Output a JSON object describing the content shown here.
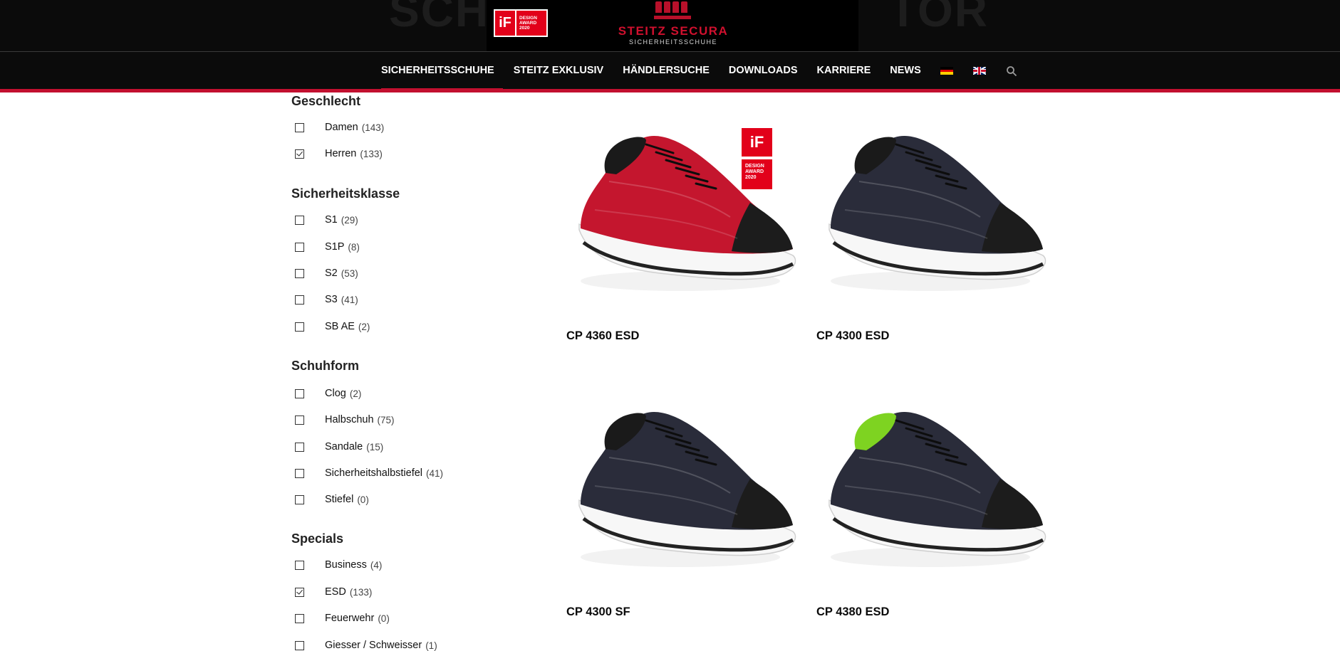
{
  "header": {
    "bg_word_left": "SCH",
    "bg_word_right": "TOR",
    "if_badge": {
      "mark": "iF",
      "lines": [
        "DESIGN",
        "AWARD",
        "2020"
      ]
    },
    "brand_name": "STEITZ SECURA",
    "brand_sub": "SICHERHEITSSCHUHE",
    "accent_color": "#c2102f"
  },
  "nav": {
    "items": [
      {
        "label": "SICHERHEITSSCHUHE",
        "active": true
      },
      {
        "label": "STEITZ EXKLUSIV",
        "active": false
      },
      {
        "label": "HÄNDLERSUCHE",
        "active": false
      },
      {
        "label": "DOWNLOADS",
        "active": false
      },
      {
        "label": "KARRIERE",
        "active": false
      },
      {
        "label": "NEWS",
        "active": false
      }
    ],
    "flags": [
      "german-flag-icon",
      "uk-flag-icon"
    ],
    "search_icon": "search-icon"
  },
  "filters": {
    "geschlecht": {
      "title": "Geschlecht",
      "items": [
        {
          "label": "Damen",
          "count": "(143)",
          "checked": false
        },
        {
          "label": "Herren",
          "count": "(133)",
          "checked": true
        }
      ]
    },
    "sicherheitsklasse": {
      "title": "Sicherheitsklasse",
      "items": [
        {
          "label": "S1",
          "count": "(29)",
          "checked": false
        },
        {
          "label": "S1P",
          "count": "(8)",
          "checked": false
        },
        {
          "label": "S2",
          "count": "(53)",
          "checked": false
        },
        {
          "label": "S3",
          "count": "(41)",
          "checked": false
        },
        {
          "label": "SB AE",
          "count": "(2)",
          "checked": false
        }
      ]
    },
    "schuhform": {
      "title": "Schuhform",
      "items": [
        {
          "label": "Clog",
          "count": "(2)",
          "checked": false
        },
        {
          "label": "Halbschuh",
          "count": "(75)",
          "checked": false
        },
        {
          "label": "Sandale",
          "count": "(15)",
          "checked": false
        },
        {
          "label": "Sicherheitshalbstiefel",
          "count": "(41)",
          "checked": false
        },
        {
          "label": "Stiefel",
          "count": "(0)",
          "checked": false
        }
      ]
    },
    "specials": {
      "title": "Specials",
      "items": [
        {
          "label": "Business",
          "count": "(4)",
          "checked": false
        },
        {
          "label": "ESD",
          "count": "(133)",
          "checked": true
        },
        {
          "label": "Feuerwehr",
          "count": "(0)",
          "checked": false
        },
        {
          "label": "Giesser / Schweisser",
          "count": "(1)",
          "checked": false
        }
      ]
    }
  },
  "products": [
    {
      "name": "CP 4360 ESD",
      "upper_color": "#c4162e",
      "collar_color": "#1a1a1a",
      "award": {
        "mark": "iF",
        "lines": [
          "DESIGN",
          "AWARD",
          "2020"
        ]
      }
    },
    {
      "name": "CP 4300 ESD",
      "upper_color": "#2a2c3a",
      "collar_color": "#1a1a1a"
    },
    {
      "name": "CP 4300 SF",
      "upper_color": "#2a2c3a",
      "collar_color": "#1a1a1a"
    },
    {
      "name": "CP 4380 ESD",
      "upper_color": "#2a2c3a",
      "collar_color": "#7ed321"
    }
  ]
}
